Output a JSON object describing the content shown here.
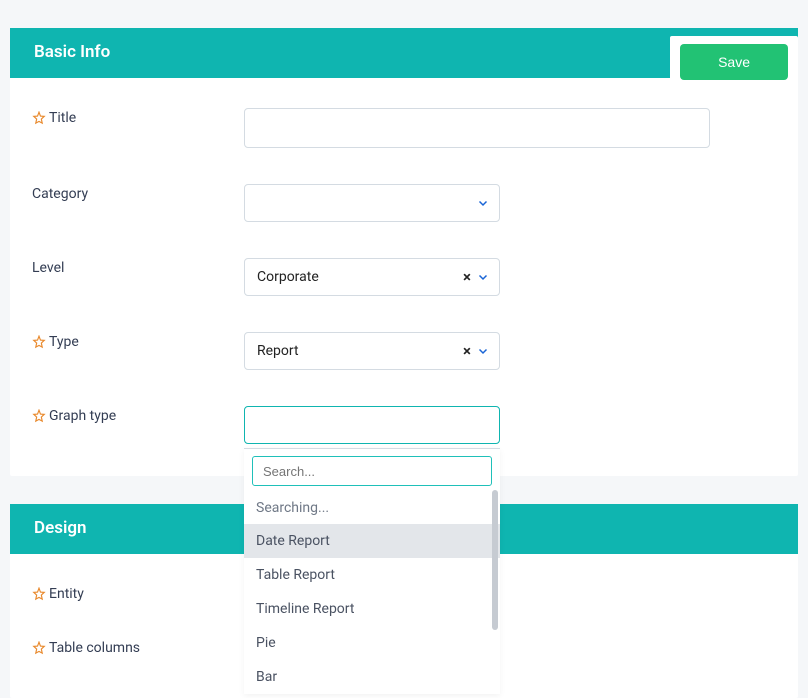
{
  "actions": {
    "save_label": "Save"
  },
  "sections": {
    "basic_info": {
      "title": "Basic Info"
    },
    "design": {
      "title": "Design"
    }
  },
  "basic_info": {
    "title": {
      "label": "Title",
      "value": ""
    },
    "category": {
      "label": "Category",
      "value": ""
    },
    "level": {
      "label": "Level",
      "value": "Corporate"
    },
    "type": {
      "label": "Type",
      "value": "Report"
    },
    "graph_type": {
      "label": "Graph type",
      "value": "",
      "search_placeholder": "Search...",
      "searching_label": "Searching...",
      "options": [
        "Date Report",
        "Table Report",
        "Timeline Report",
        "Pie",
        "Bar"
      ]
    }
  },
  "design": {
    "entity": {
      "label": "Entity"
    },
    "table_columns": {
      "label": "Table columns"
    }
  }
}
